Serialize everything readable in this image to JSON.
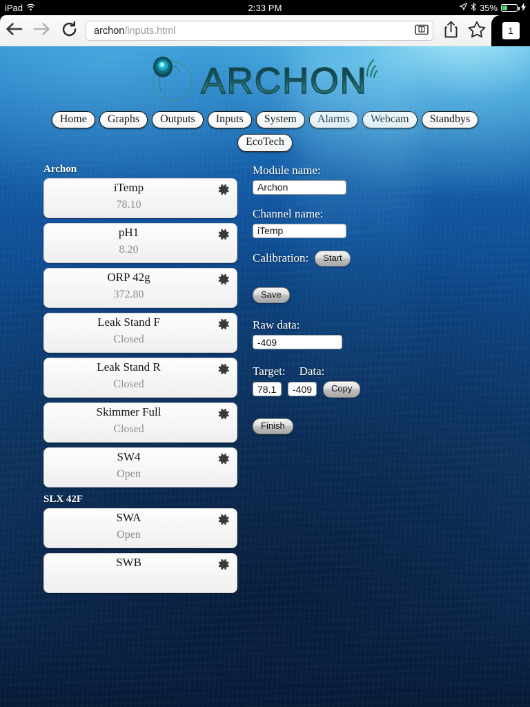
{
  "status_bar": {
    "carrier": "iPad",
    "wifi_icon": "wifi-icon",
    "time": "2:33 PM",
    "location_icon": "location-arrow-icon",
    "bluetooth_icon": "bluetooth-icon",
    "battery_percent": "35%",
    "battery_icon": "battery-icon",
    "charging_icon": "lightning-bolt-icon"
  },
  "browser": {
    "back_icon": "back-arrow-icon",
    "forward_icon": "forward-arrow-icon",
    "reload_icon": "reload-icon",
    "url_domain": "archon",
    "url_path": "/inputs.html",
    "reader_icon": "reader-view-icon",
    "share_icon": "share-icon",
    "bookmark_icon": "bookmark-star-icon",
    "tab_count": "1"
  },
  "header": {
    "logo_wordmark": "ARCHON",
    "logo_mark_icon": "archon-circle-logo-icon",
    "logo_signal_icon": "signal-waves-icon"
  },
  "nav": {
    "row1": [
      {
        "label": "Home"
      },
      {
        "label": "Graphs"
      },
      {
        "label": "Outputs"
      },
      {
        "label": "Inputs"
      },
      {
        "label": "System"
      },
      {
        "label": "Alarms"
      },
      {
        "label": "Webcam"
      },
      {
        "label": "Standbys"
      }
    ],
    "row2": [
      {
        "label": "EcoTech"
      }
    ]
  },
  "channel_list": {
    "groups": [
      {
        "title": "Archon",
        "items": [
          {
            "name": "iTemp",
            "value": "78.10"
          },
          {
            "name": "pH1",
            "value": "8.20"
          },
          {
            "name": "ORP 42g",
            "value": "372.80"
          },
          {
            "name": "Leak Stand F",
            "value": "Closed"
          },
          {
            "name": "Leak Stand R",
            "value": "Closed"
          },
          {
            "name": "Skimmer Full",
            "value": "Closed"
          },
          {
            "name": "SW4",
            "value": "Open"
          }
        ]
      },
      {
        "title": "SLX 42F",
        "items": [
          {
            "name": "SWA",
            "value": "Open"
          },
          {
            "name": "SWB",
            "value": ""
          }
        ]
      }
    ],
    "gear_icon": "gear-icon"
  },
  "form": {
    "module_name_label": "Module name:",
    "module_name_value": "Archon",
    "channel_name_label": "Channel name:",
    "channel_name_value": "iTemp",
    "calibration_label": "Calibration:",
    "calibration_start_button": "Start",
    "save_button": "Save",
    "raw_data_label": "Raw data:",
    "raw_data_value": "-409",
    "target_label": "Target:",
    "data_label": "Data:",
    "target_value": "78.1",
    "data_value": "-409",
    "copy_button": "Copy",
    "finish_button": "Finish"
  },
  "colors": {
    "accent_teal": "#1a4d52",
    "background_top": "#2b8fd0",
    "background_bottom": "#05142b",
    "battery_green": "#4cd964",
    "card_bg": "#f7f7f7",
    "card_value_text": "#8d8d8d"
  }
}
